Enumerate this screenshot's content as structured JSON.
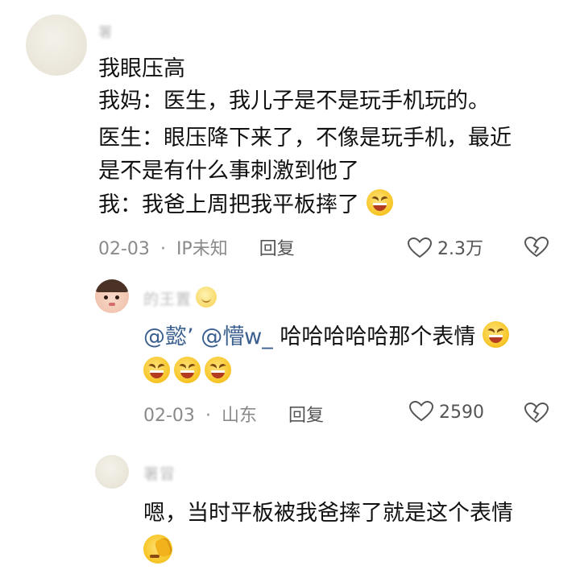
{
  "comments": [
    {
      "user": {
        "name": "署"
      },
      "lines": [
        "我眼压高",
        "我妈：医生，我儿子是不是玩手机玩的。",
        "医生：眼压降下来了，不像是玩手机，最近",
        "是不是有什么事刺激到他了",
        "我：我爸上周把我平板摔了"
      ],
      "emoji": "grinning-squint-emoji",
      "date": "02-03",
      "location": "IP未知",
      "reply_label": "回复",
      "likes": "2.3万"
    },
    {
      "user": {
        "name": "的王置"
      },
      "mention1": "@懿’",
      "mention2": "@懵w_",
      "text": "哈哈哈哈哈那个表情",
      "emojis": [
        "grinning-squint-emoji",
        "grinning-squint-emoji",
        "grinning-squint-emoji",
        "grinning-squint-emoji"
      ],
      "date": "02-03",
      "location": "山东",
      "reply_label": "回复",
      "likes": "2590"
    },
    {
      "user": {
        "name": "署冒"
      },
      "text": "嗯，当时平板被我爸摔了就是这个表情",
      "emoji": "facepalm-emoji"
    }
  ],
  "separator": "·"
}
